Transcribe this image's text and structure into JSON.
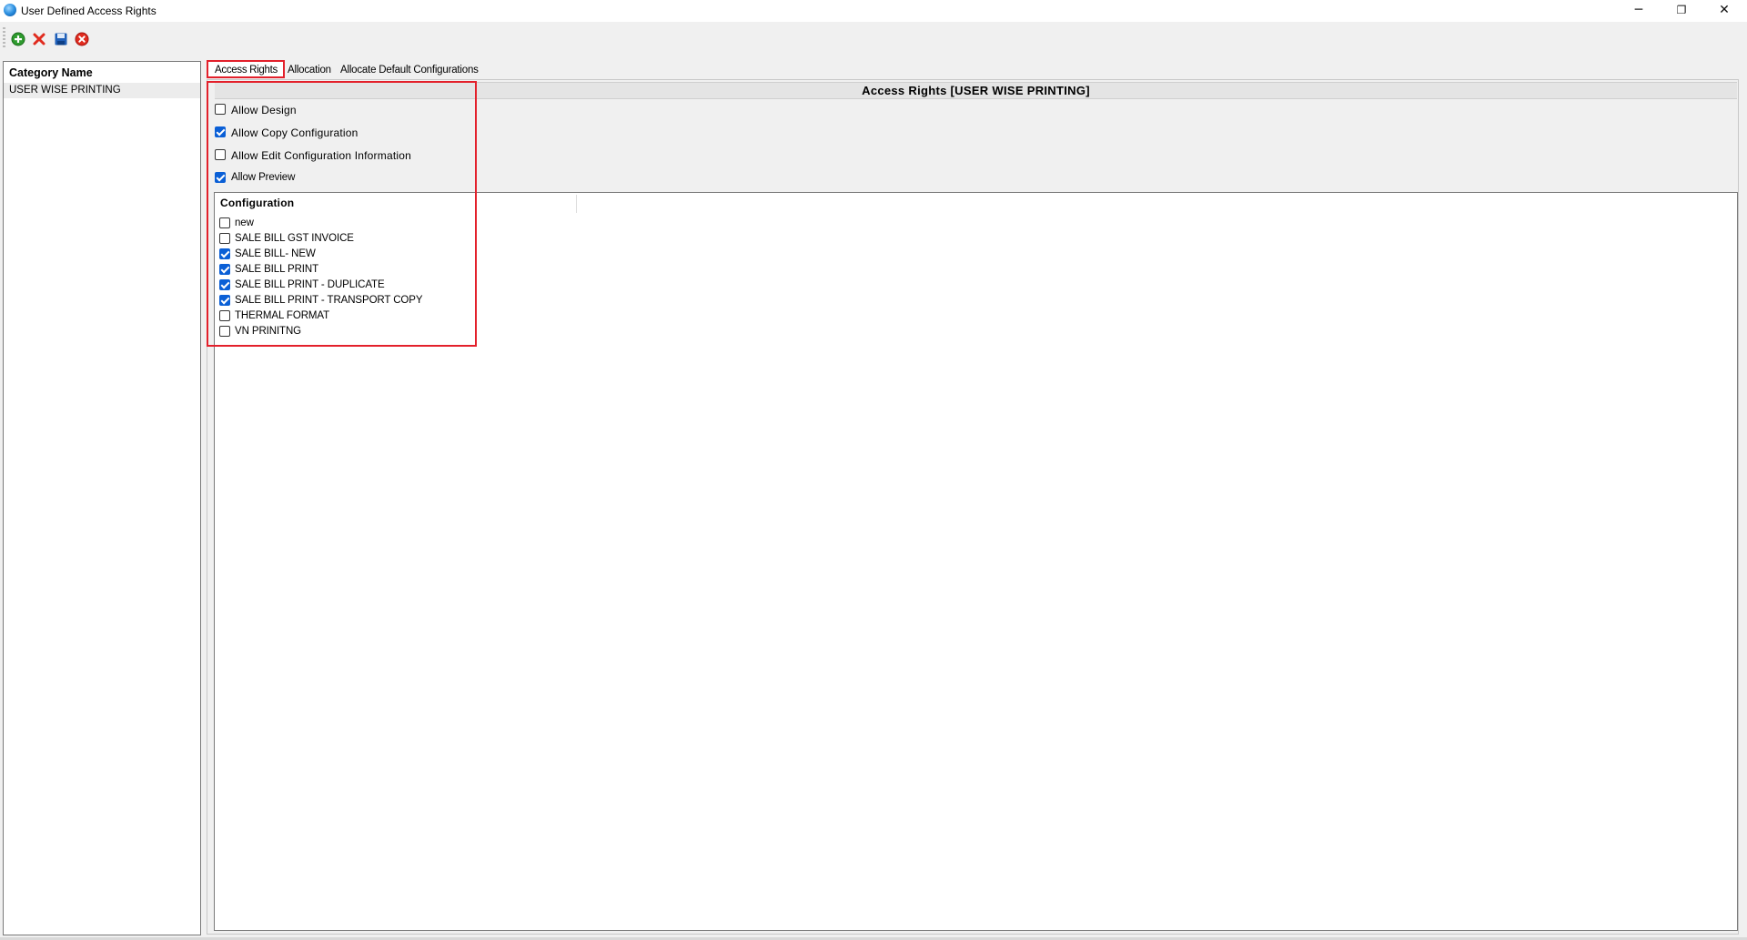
{
  "window": {
    "title": "User Defined Access Rights",
    "controls": {
      "minimize": "─",
      "maximize": "❐",
      "close": "✕"
    }
  },
  "toolbar": {
    "buttons": [
      {
        "name": "add-icon",
        "color": "#2e9b2e"
      },
      {
        "name": "delete-icon",
        "color": "#e02b1e"
      },
      {
        "name": "save-icon",
        "color": "#1f5fb8"
      },
      {
        "name": "exit-icon",
        "color": "#e02b1e"
      }
    ]
  },
  "sidebar": {
    "header": "Category Name",
    "items": [
      {
        "label": "USER WISE PRINTING",
        "selected": true
      }
    ]
  },
  "tabs": [
    {
      "label": "Access Rights",
      "active": true
    },
    {
      "label": "Allocation",
      "active": false
    },
    {
      "label": "Allocate Default Configurations",
      "active": false
    }
  ],
  "access_rights": {
    "heading": "Access Rights [USER WISE PRINTING]",
    "options": [
      {
        "label": "Allow Design",
        "checked": false
      },
      {
        "label": "Allow Copy Configuration",
        "checked": true
      },
      {
        "label": "Allow Edit Configuration Information",
        "checked": false
      },
      {
        "label": "Allow Preview",
        "checked": true
      }
    ]
  },
  "configuration": {
    "header": "Configuration",
    "items": [
      {
        "label": "new",
        "checked": false
      },
      {
        "label": "SALE BILL GST INVOICE",
        "checked": false
      },
      {
        "label": "SALE BILL- NEW",
        "checked": true
      },
      {
        "label": "SALE BILL PRINT",
        "checked": true
      },
      {
        "label": "SALE BILL PRINT - DUPLICATE",
        "checked": true
      },
      {
        "label": "SALE BILL PRINT - TRANSPORT COPY",
        "checked": true
      },
      {
        "label": "THERMAL FORMAT",
        "checked": false
      },
      {
        "label": "VN PRINITNG",
        "checked": false
      }
    ]
  },
  "colors": {
    "highlight": "#e3202b",
    "check_blue": "#0a5fd6"
  }
}
